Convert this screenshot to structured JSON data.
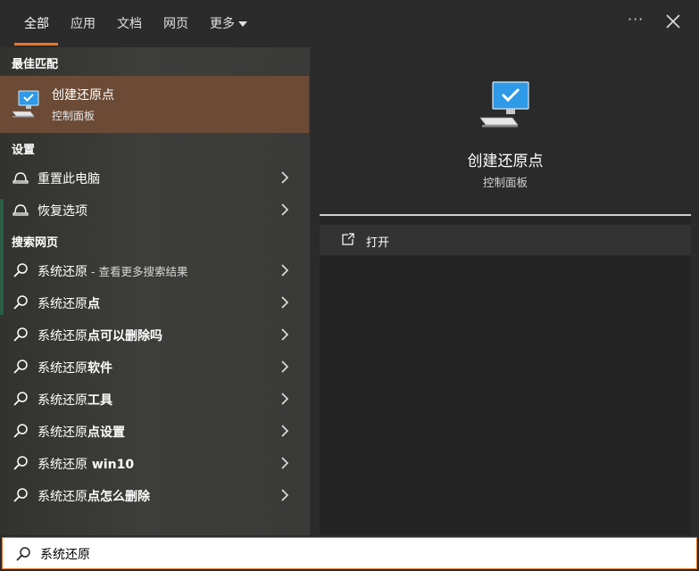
{
  "tabs": [
    {
      "label": "全部",
      "active": true
    },
    {
      "label": "应用"
    },
    {
      "label": "文档"
    },
    {
      "label": "网页"
    },
    {
      "label": "更多"
    }
  ],
  "accent_color": "#e8762c",
  "sections": {
    "best_match": "最佳匹配",
    "settings": "设置",
    "web": "搜索网页"
  },
  "best_match": {
    "title": "创建还原点",
    "subtitle": "控制面板",
    "icon": "computer-monitor-icon"
  },
  "settings_items": [
    {
      "label": "重置此电脑",
      "icon": "reset-pc-icon"
    },
    {
      "label": "恢复选项",
      "icon": "recovery-icon"
    }
  ],
  "web_items": [
    {
      "prefix": "系统还原",
      "bold": "",
      "suffix": " - 查看更多搜索结果"
    },
    {
      "prefix": "系统还原",
      "bold": "点",
      "suffix": ""
    },
    {
      "prefix": "系统还原",
      "bold": "点可以删除吗",
      "suffix": ""
    },
    {
      "prefix": "系统还原",
      "bold": "软件",
      "suffix": ""
    },
    {
      "prefix": "系统还原",
      "bold": "工具",
      "suffix": ""
    },
    {
      "prefix": "系统还原",
      "bold": "点设置",
      "suffix": ""
    },
    {
      "prefix": "系统还原",
      "bold": " win10",
      "suffix": ""
    },
    {
      "prefix": "系统还原",
      "bold": "点怎么删除",
      "suffix": ""
    }
  ],
  "preview": {
    "title": "创建还原点",
    "subtitle": "控制面板",
    "open_label": "打开"
  },
  "search": {
    "value": "系统还原",
    "placeholder": ""
  }
}
